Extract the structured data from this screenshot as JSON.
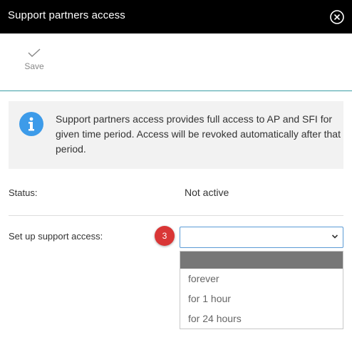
{
  "header": {
    "title": "Support partners access",
    "close_icon": "close-circle-icon"
  },
  "toolbar": {
    "save_label": "Save",
    "save_icon": "checkmark-icon"
  },
  "info": {
    "icon": "info-icon",
    "text": "Support partners access provides full access to AP and SFI for given time period. Access will be revoked automatically after that period."
  },
  "status": {
    "label": "Status:",
    "value": "Not active"
  },
  "support_access": {
    "label": "Set up support access:",
    "step_badge": "3",
    "selected_value": "",
    "options": [
      "",
      "forever",
      "for 1 hour",
      "for 24 hours"
    ]
  },
  "colors": {
    "titlebar_bg": "#000000",
    "accent_line": "#3a9ea5",
    "info_icon": "#3d9be9",
    "badge": "#d93636",
    "select_border": "#5b9bd5",
    "highlight_option": "#777777"
  }
}
